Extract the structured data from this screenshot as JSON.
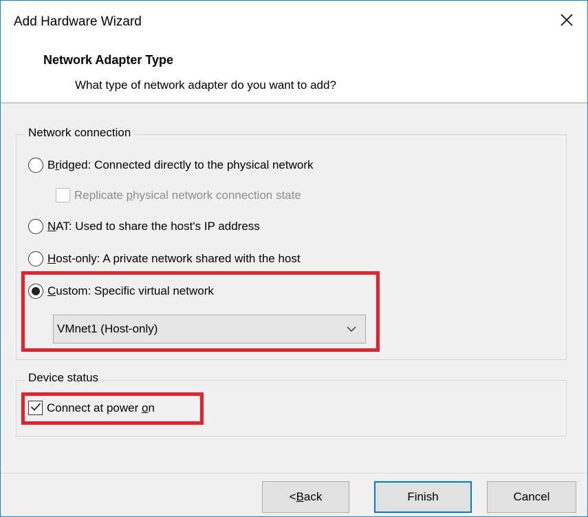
{
  "window": {
    "title": "Add Hardware Wizard",
    "close_symbol": "✕"
  },
  "header": {
    "title": "Network Adapter Type",
    "subtitle": "What type of network adapter do you want to add?"
  },
  "network_connection": {
    "legend": "Network connection",
    "options": [
      {
        "pre": "B",
        "key": "r",
        "post": "idged: Connected directly to the physical network",
        "selected": false
      },
      {
        "pre": "",
        "key": "N",
        "post": "AT: Used to share the host's IP address",
        "selected": false
      },
      {
        "pre": "",
        "key": "H",
        "post": "ost-only: A private network shared with the host",
        "selected": false
      },
      {
        "pre": "",
        "key": "C",
        "post": "ustom: Specific virtual network",
        "selected": true
      }
    ],
    "replicate": {
      "pre": "Replicate ",
      "key": "p",
      "post": "hysical network connection state",
      "checked": false,
      "enabled": false
    },
    "custom_network": {
      "selected": "VMnet1 (Host-only)"
    }
  },
  "device_status": {
    "legend": "Device status",
    "connect": {
      "pre": "Connect at power ",
      "key": "o",
      "post": "n",
      "checked": true
    }
  },
  "buttons": {
    "back": {
      "pre": "< ",
      "key": "B",
      "post": "ack"
    },
    "finish": "Finish",
    "cancel": "Cancel"
  },
  "colors": {
    "highlight": "#e8202a",
    "accent": "#0078d7",
    "window_border": "#1883d7"
  },
  "icons": [
    "close-icon",
    "chevron-down-icon",
    "checkmark-icon"
  ]
}
